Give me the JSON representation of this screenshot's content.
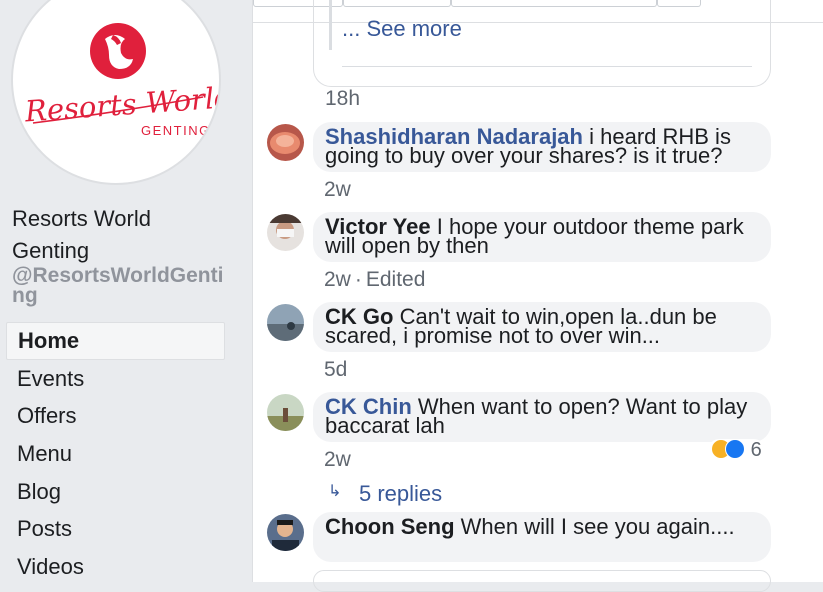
{
  "page": {
    "logo_text": "Resorts World",
    "logo_subtext": "GENTING",
    "name": "Resorts World Genting",
    "handle": "@ResortsWorldGenting"
  },
  "nav": {
    "items": [
      {
        "label": "Home",
        "active": true
      },
      {
        "label": "Events"
      },
      {
        "label": "Offers"
      },
      {
        "label": "Menu"
      },
      {
        "label": "Blog"
      },
      {
        "label": "Posts"
      },
      {
        "label": "Videos"
      }
    ]
  },
  "post": {
    "see_more": "... See more",
    "time": "18h"
  },
  "comments": [
    {
      "author": "Shashidharan Nadarajah",
      "text": "i heard RHB is going to buy over your shares? is it true?",
      "time": "2w",
      "edited": ""
    },
    {
      "author": "Victor Yee",
      "text": "I hope your outdoor theme park will open by then",
      "time": "2w",
      "edited": "Edited"
    },
    {
      "author": "CK Go",
      "text": "Can't wait to win,open la..dun be scared, i promise not to over win...",
      "time": "5d",
      "edited": ""
    },
    {
      "author": "CK Chin",
      "text": "When want to open? Want to play baccarat lah",
      "time": "2w",
      "edited": "",
      "reaction_count": "6"
    },
    {
      "author": "Choon Seng",
      "text": "When will I see you again....",
      "time": "",
      "edited": ""
    }
  ],
  "replies": {
    "label": "5 replies"
  },
  "colors": {
    "link_blue": "#385898",
    "brand_red": "#e0203c",
    "bubble_gray": "#f2f3f5"
  }
}
